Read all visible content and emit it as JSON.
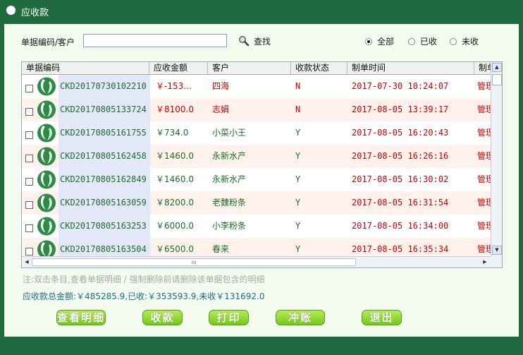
{
  "window": {
    "title": "应收款"
  },
  "filter": {
    "label": "单据编码/客户",
    "input_value": "",
    "search_label": "查找"
  },
  "radio": [
    {
      "label": "全部",
      "selected": true
    },
    {
      "label": "已收",
      "selected": false
    },
    {
      "label": "未收",
      "selected": false
    }
  ],
  "table": {
    "columns": [
      "单据编码",
      "应收金额",
      "客户",
      "收款状态",
      "制单时间",
      "制单"
    ],
    "rows": [
      {
        "code": "CKD20170730102210",
        "amount": "￥-153...",
        "customer": "四海",
        "status": "N",
        "time": "2017-07-30 10:24:07",
        "maker": "管理"
      },
      {
        "code": "CKD20170805133724",
        "amount": "￥8100.0",
        "customer": "志娟",
        "status": "N",
        "time": "2017-08-05 13:39:17",
        "maker": "管理"
      },
      {
        "code": "CKD20170805161755",
        "amount": "￥734.0",
        "customer": "小菜小王",
        "status": "Y",
        "time": "2017-08-05 16:20:43",
        "maker": "管理"
      },
      {
        "code": "CKD20170805162458",
        "amount": "￥1460.0",
        "customer": "永新水产",
        "status": "Y",
        "time": "2017-08-05 16:26:16",
        "maker": "管理"
      },
      {
        "code": "CKD20170805162849",
        "amount": "￥1460.0",
        "customer": "永新水产",
        "status": "Y",
        "time": "2017-08-05 16:30:02",
        "maker": "管理"
      },
      {
        "code": "CKD20170805163059",
        "amount": "￥8200.0",
        "customer": "老魏粉条",
        "status": "Y",
        "time": "2017-08-05 16:31:54",
        "maker": "管理"
      },
      {
        "code": "CKD20170805163253",
        "amount": "￥6000.0",
        "customer": "小李粉条",
        "status": "Y",
        "time": "2017-08-05 16:34:00",
        "maker": "管理"
      },
      {
        "code": "CKD20170805163504",
        "amount": "￥6500.0",
        "customer": "春来",
        "status": "Y",
        "time": "2017-08-05 16:35:34",
        "maker": "管理"
      }
    ]
  },
  "note": "注:双击条目,查看单据明细   /   强制删除前请删除该单据包含的明细",
  "summary": "应收款总金额:￥485285.9,已收:￥353593.9,未收￥131692.0",
  "buttons": {
    "detail": "查看明细",
    "collect": "收款",
    "print": "打印",
    "offset": "冲账",
    "exit": "退出"
  },
  "colors": {
    "frame": "#1f6a3e",
    "panel": "#f3fbee",
    "button": "#8fd42a",
    "unpaid": "#cc0000",
    "paid": "#1d6e2a"
  }
}
